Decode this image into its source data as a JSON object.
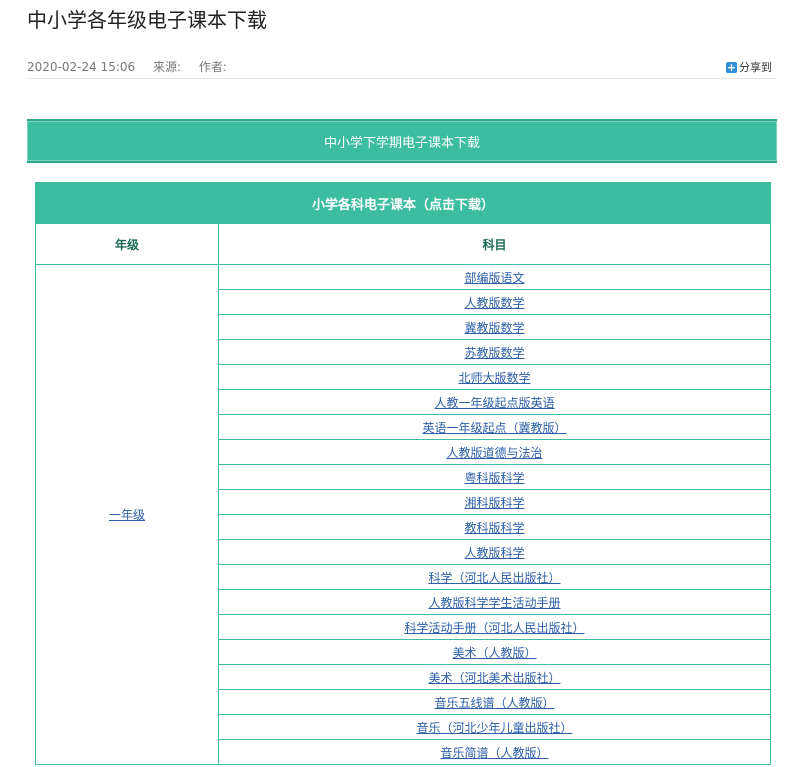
{
  "article": {
    "title": "中小学各年级电子课本下载",
    "date": "2020-02-24 15:06",
    "source_label": "来源:",
    "author_label": "作者:",
    "share_label": "分享到"
  },
  "banner": {
    "title": "中小学下学期电子课本下载"
  },
  "table": {
    "title": "小学各科电子课本（点击下载）",
    "headers": [
      "年级",
      "科目"
    ],
    "grade": "一年级",
    "subjects": [
      "部编版语文",
      "人教版数学",
      "冀教版数学",
      "苏教版数学",
      "北师大版数学",
      "人教一年级起点版英语",
      "英语一年级起点（冀教版）",
      "人教版道德与法治",
      "粤科版科学",
      "湘科版科学",
      "教科版科学",
      "人教版科学",
      "科学（河北人民出版社）",
      "人教版科学学生活动手册",
      "科学活动手册（河北人民出版社）",
      "美术（人教版）",
      "美术（河北美术出版社）",
      "音乐五线谱（人教版）",
      "音乐（河北少年儿童出版社）",
      "音乐简谱（人教版）"
    ]
  }
}
